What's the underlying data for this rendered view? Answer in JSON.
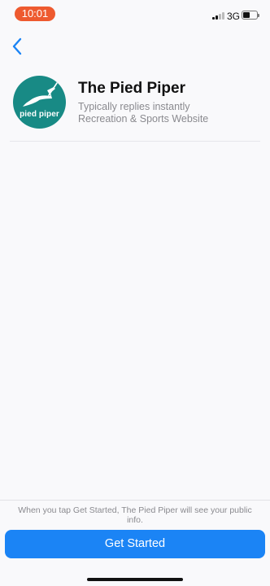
{
  "status_bar": {
    "time": "10:01",
    "network": "3G"
  },
  "page": {
    "title": "The Pied Piper",
    "reply_status": "Typically replies instantly",
    "category": "Recreation & Sports Website",
    "avatar_text": "pied piper"
  },
  "footer": {
    "notice": "When you tap Get Started, The Pied Piper will see your public info.",
    "button_label": "Get Started"
  },
  "colors": {
    "accent": "#1b84f5",
    "avatar_bg": "#188a85",
    "time_pill": "#ee5a2f"
  },
  "icons": {
    "back": "chevron-left-icon",
    "logo": "pied-piper-logo"
  }
}
